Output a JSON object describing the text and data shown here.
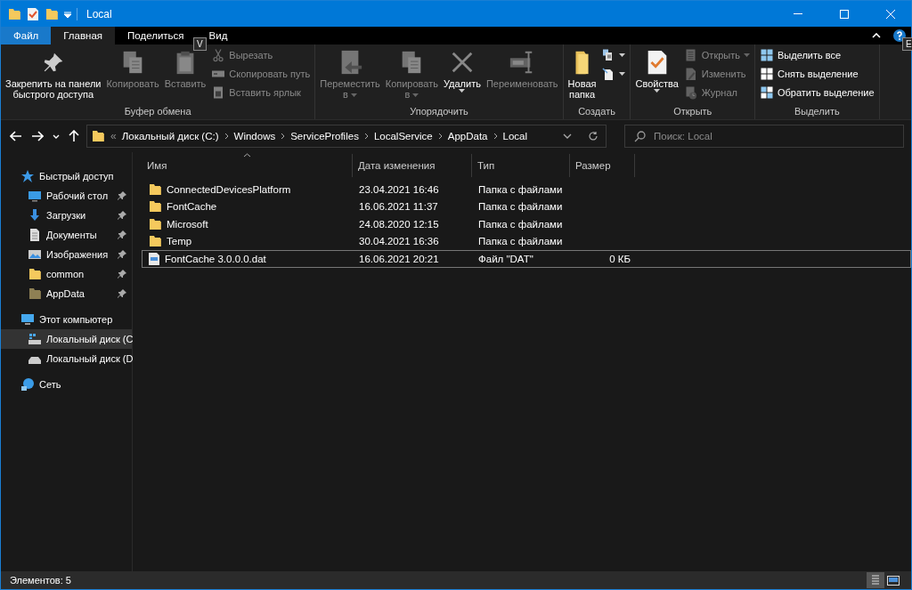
{
  "window": {
    "title": "Local",
    "quick_access": [
      {
        "kind": "folder"
      },
      {
        "kind": "properties"
      },
      {
        "kind": "folder"
      },
      {
        "kind": "customize"
      }
    ]
  },
  "tabs": [
    {
      "label": "Файл",
      "kind": "file",
      "selected": false
    },
    {
      "label": "Главная",
      "kind": "tab",
      "selected": true
    },
    {
      "label": "Поделиться",
      "kind": "tab",
      "selected": false
    },
    {
      "label": "Вид",
      "kind": "tab",
      "selected": false
    }
  ],
  "keytips": [
    "V",
    "E"
  ],
  "ribbon": [
    {
      "label": "Буфер обмена",
      "columns": [
        [
          {
            "kind": "pin",
            "label": "Закрепить на панели\nбыстрого доступа",
            "disabled": false
          }
        ],
        [
          {
            "kind": "copy",
            "label": "Копировать",
            "disabled": true
          }
        ],
        [
          {
            "kind": "paste",
            "label": "Вставить",
            "disabled": true
          }
        ],
        [
          {
            "kind": "cut",
            "label": "Вырезать",
            "disabled": true
          },
          {
            "kind": "path",
            "label": "Скопировать путь",
            "disabled": true
          },
          {
            "kind": "shortcut",
            "label": "Вставить ярлык",
            "disabled": true
          }
        ]
      ]
    },
    {
      "label": "Упорядочить",
      "columns": [
        [
          {
            "kind": "move",
            "label": "Переместить\nв",
            "dropdown": true,
            "disabled": true
          }
        ],
        [
          {
            "kind": "copyto",
            "label": "Копировать\nв",
            "dropdown": true,
            "disabled": true
          }
        ],
        [
          {
            "kind": "delete",
            "label": "Удалить",
            "dropdown": true,
            "disabled": false
          }
        ],
        [
          {
            "kind": "rename",
            "label": "Переименовать",
            "disabled": true
          }
        ]
      ]
    },
    {
      "label": "Создать",
      "columns": [
        [
          {
            "kind": "newfolder",
            "label": "Новая\nпапка",
            "disabled": false
          }
        ],
        [
          {
            "kind": "newitem",
            "dropdown": true,
            "disabled": false
          },
          {
            "kind": "easyaccess",
            "dropdown": true,
            "disabled": false
          }
        ]
      ]
    },
    {
      "label": "Открыть",
      "columns": [
        [
          {
            "kind": "properties",
            "label": "Свойства",
            "dropdown": true,
            "disabled": false
          }
        ],
        [
          {
            "kind": "open",
            "label": "Открыть",
            "dropdown": true,
            "disabled": true
          },
          {
            "kind": "edit",
            "label": "Изменить",
            "disabled": true
          },
          {
            "kind": "history",
            "label": "Журнал",
            "disabled": true
          }
        ]
      ]
    },
    {
      "label": "Выделить",
      "columns": [
        [
          {
            "kind": "selectall",
            "label": "Выделить все",
            "disabled": false
          },
          {
            "kind": "selectnone",
            "label": "Снять выделение",
            "disabled": false
          },
          {
            "kind": "invert",
            "label": "Обратить выделение",
            "disabled": false
          }
        ]
      ]
    }
  ],
  "address": {
    "overflow": "«",
    "segments": [
      "Локальный диск (C:)",
      "Windows",
      "ServiceProfiles",
      "LocalService",
      "AppData",
      "Local"
    ]
  },
  "search": {
    "placeholder": "Поиск: Local"
  },
  "sidebar": {
    "items": [
      {
        "label": "Быстрый доступ",
        "kind": "star",
        "selected": false,
        "children": [
          {
            "label": "Рабочий стол",
            "kind": "desktop",
            "pinned": true,
            "selected": false
          },
          {
            "label": "Загрузки",
            "kind": "downloads",
            "pinned": true,
            "selected": false
          },
          {
            "label": "Документы",
            "kind": "documents",
            "pinned": true,
            "selected": false
          },
          {
            "label": "Изображения",
            "kind": "pictures",
            "pinned": true,
            "selected": false
          },
          {
            "label": "common",
            "kind": "folder",
            "pinned": true,
            "selected": false
          },
          {
            "label": "AppData",
            "kind": "hiddenfolder",
            "pinned": true,
            "selected": false
          }
        ]
      },
      {
        "label": "Этот компьютер",
        "kind": "computer",
        "selected": false,
        "children": [
          {
            "label": "Локальный диск (C",
            "kind": "systemdrive",
            "selected": true
          },
          {
            "label": "Локальный диск (D",
            "kind": "drive",
            "selected": false
          }
        ]
      },
      {
        "label": "Сеть",
        "kind": "network",
        "selected": false
      }
    ]
  },
  "table": {
    "columns": [
      "Имя",
      "Дата изменения",
      "Тип",
      "Размер"
    ],
    "rows": [
      {
        "kind": "folder",
        "name": "ConnectedDevicesPlatform",
        "date": "23.04.2021 16:46",
        "type": "Папка с файлами",
        "selected": false
      },
      {
        "kind": "folder",
        "name": "FontCache",
        "date": "16.06.2021 11:37",
        "type": "Папка с файлами",
        "selected": false
      },
      {
        "kind": "folder",
        "name": "Microsoft",
        "date": "24.08.2020 12:15",
        "type": "Папка с файлами",
        "selected": false
      },
      {
        "kind": "folder",
        "name": "Temp",
        "date": "30.04.2021 16:36",
        "type": "Папка с файлами",
        "selected": false
      },
      {
        "kind": "file",
        "name": "FontCache 3.0.0.0.dat",
        "date": "16.06.2021 20:21",
        "type": "Файл \"DAT\"",
        "size": "0 КБ",
        "selected": true
      }
    ]
  },
  "status_bar": {
    "count": "Элементов: 5",
    "views": [
      {
        "kind": "details",
        "selected": true
      },
      {
        "kind": "tiles",
        "selected": false
      }
    ]
  }
}
